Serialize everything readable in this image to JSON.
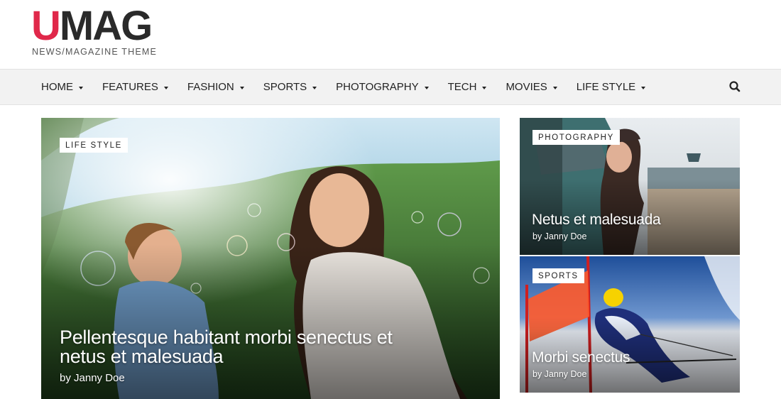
{
  "logo": {
    "first_letter": "U",
    "rest": "MAG",
    "tagline": "NEWS/MAGAZINE THEME",
    "accent_color": "#e0284a"
  },
  "nav": {
    "items": [
      {
        "label": "HOME"
      },
      {
        "label": "FEATURES"
      },
      {
        "label": "FASHION"
      },
      {
        "label": "SPORTS"
      },
      {
        "label": "PHOTOGRAPHY"
      },
      {
        "label": "TECH"
      },
      {
        "label": "MOVIES"
      },
      {
        "label": "LIFE STYLE"
      }
    ],
    "search_icon": "search-icon"
  },
  "featured": {
    "main": {
      "category": "LIFE STYLE",
      "title": "Pellentesque habitant morbi senectus et netus et malesuada",
      "byline": "by Janny Doe"
    },
    "side": [
      {
        "category": "PHOTOGRAPHY",
        "title": "Netus et malesuada",
        "byline": "by Janny Doe"
      },
      {
        "category": "SPORTS",
        "title": "Morbi senectus",
        "byline": "by Janny Doe"
      }
    ]
  }
}
